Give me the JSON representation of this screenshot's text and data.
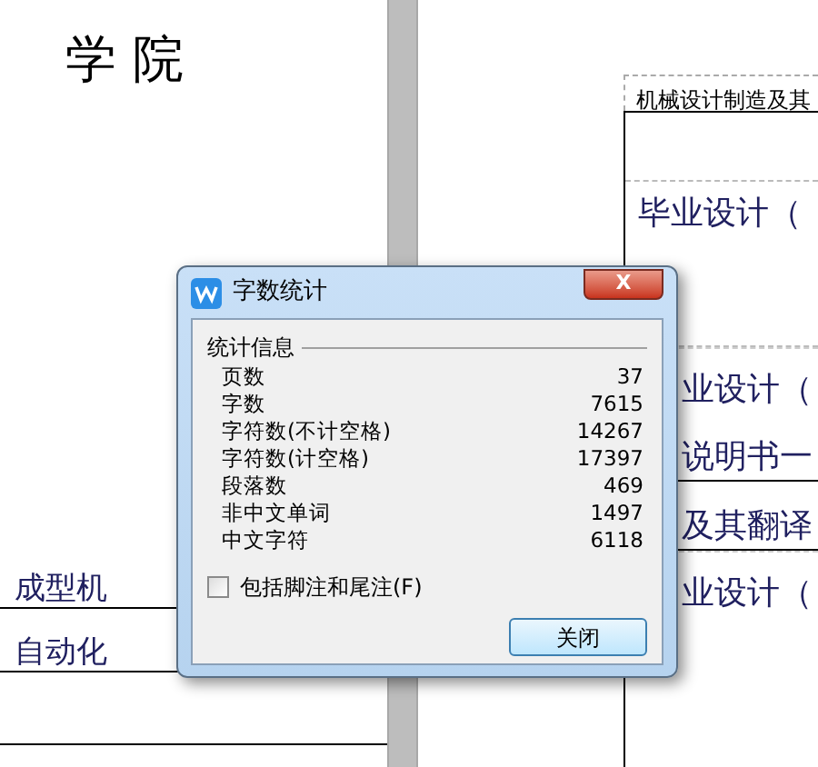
{
  "left_page": {
    "heading": "学 院",
    "fields": [
      "成型机",
      "自动化"
    ]
  },
  "right_page": {
    "header": "机械设计制造及其",
    "title": "毕业设计（",
    "rows": [
      {
        "text": "业设计（",
        "underlined": false
      },
      {
        "text": "说明书一",
        "underlined": true
      },
      {
        "text": "及其翻译",
        "underlined": true
      },
      {
        "text": "业设计（",
        "underlined": false
      }
    ]
  },
  "dialog": {
    "title": "字数统计",
    "close_label": "X",
    "group": "统计信息",
    "stats": [
      {
        "label": "页数",
        "value": "37"
      },
      {
        "label": "字数",
        "value": "7615"
      },
      {
        "label": "字符数(不计空格)",
        "value": "14267"
      },
      {
        "label": "字符数(计空格)",
        "value": "17397"
      },
      {
        "label": "段落数",
        "value": "469"
      },
      {
        "label": "非中文单词",
        "value": "1497"
      },
      {
        "label": "中文字符",
        "value": "6118"
      }
    ],
    "checkbox": {
      "label": "包括脚注和尾注(F)",
      "checked": false
    },
    "button": "关闭"
  }
}
